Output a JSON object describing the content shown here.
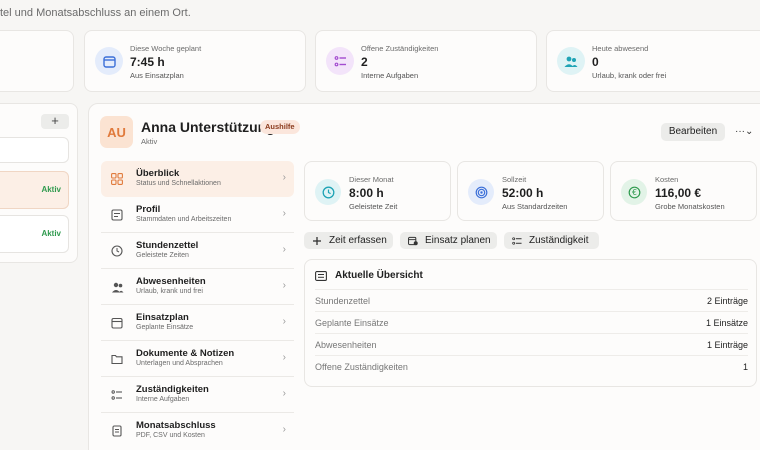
{
  "header": {
    "intro_text": "tel und Monatsabschluss an einem Ort."
  },
  "stats": [
    {
      "label": "Diese Woche geplant",
      "value": "7:45 h",
      "sub": "Aus Einsatzplan",
      "icon": "calendar-icon",
      "color": "#3b6fd8"
    },
    {
      "label": "Offene Zuständigkeiten",
      "value": "2",
      "sub": "Interne Aufgaben",
      "icon": "checklist-icon",
      "color": "#a34bd0"
    },
    {
      "label": "Heute abwesend",
      "value": "0",
      "sub": "Urlaub, krank oder frei",
      "icon": "people-icon",
      "color": "#1fa3b5"
    }
  ],
  "left_list": {
    "add_label": "+",
    "rows": [
      {
        "status": ""
      },
      {
        "status": "Aktiv"
      },
      {
        "status": "Aktiv"
      }
    ]
  },
  "profile": {
    "initials": "AU",
    "name": "Anna Unterstützung",
    "badge": "Aushilfe",
    "status": "Aktiv",
    "edit_label": "Bearbeiten",
    "more_label": "···⌄"
  },
  "nav": [
    {
      "label": "Überblick",
      "sub": "Status und Schnellaktionen",
      "icon": "grid-icon"
    },
    {
      "label": "Profil",
      "sub": "Stammdaten und Arbeitszeiten",
      "icon": "id-card-icon"
    },
    {
      "label": "Stundenzettel",
      "sub": "Geleistete Zeiten",
      "icon": "clock-icon"
    },
    {
      "label": "Abwesenheiten",
      "sub": "Urlaub, krank und frei",
      "icon": "people-icon"
    },
    {
      "label": "Einsatzplan",
      "sub": "Geplante Einsätze",
      "icon": "calendar-icon"
    },
    {
      "label": "Dokumente & Notizen",
      "sub": "Unterlagen und Absprachen",
      "icon": "folder-icon"
    },
    {
      "label": "Zuständigkeiten",
      "sub": "Interne Aufgaben",
      "icon": "checklist-icon"
    },
    {
      "label": "Monatsabschluss",
      "sub": "PDF, CSV und Kosten",
      "icon": "document-icon"
    }
  ],
  "kpis": [
    {
      "label": "Dieser Monat",
      "value": "8:00 h",
      "sub": "Geleistete Zeit",
      "icon": "clock-icon",
      "color": "#1fa3b5"
    },
    {
      "label": "Sollzeit",
      "value": "52:00 h",
      "sub": "Aus Standardzeiten",
      "icon": "target-icon",
      "color": "#3b6fd8"
    },
    {
      "label": "Kosten",
      "value": "116,00 €",
      "sub": "Grobe Monatskosten",
      "icon": "euro-icon",
      "color": "#2f9a4e"
    }
  ],
  "actions": [
    {
      "label": "Zeit erfassen",
      "icon": "plus-icon"
    },
    {
      "label": "Einsatz planen",
      "icon": "calendar-plus-icon"
    },
    {
      "label": "Zuständigkeit",
      "icon": "checklist-icon"
    }
  ],
  "overview": {
    "title": "Aktuelle Übersicht",
    "rows": [
      {
        "label": "Stundenzettel",
        "value": "2 Einträge"
      },
      {
        "label": "Geplante Einsätze",
        "value": "1 Einsätze"
      },
      {
        "label": "Abwesenheiten",
        "value": "1 Einträge"
      },
      {
        "label": "Offene Zuständigkeiten",
        "value": "1"
      }
    ]
  },
  "colors": {
    "accent": "#e07a3c",
    "active_bg": "#fcefe6",
    "success": "#2f9a4e"
  }
}
